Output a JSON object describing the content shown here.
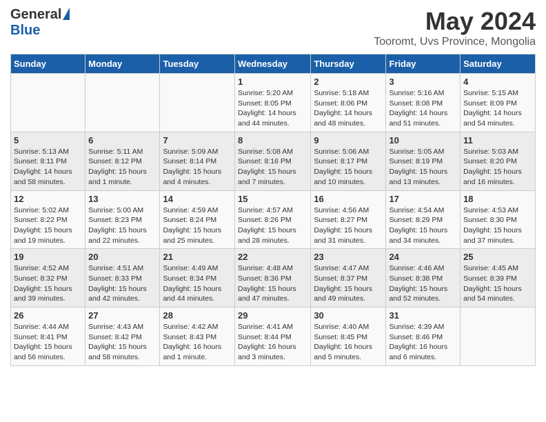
{
  "logo": {
    "general": "General",
    "blue": "Blue"
  },
  "title": "May 2024",
  "subtitle": "Tooromt, Uvs Province, Mongolia",
  "days_of_week": [
    "Sunday",
    "Monday",
    "Tuesday",
    "Wednesday",
    "Thursday",
    "Friday",
    "Saturday"
  ],
  "weeks": [
    [
      {
        "day": "",
        "info": ""
      },
      {
        "day": "",
        "info": ""
      },
      {
        "day": "",
        "info": ""
      },
      {
        "day": "1",
        "info": "Sunrise: 5:20 AM\nSunset: 8:05 PM\nDaylight: 14 hours\nand 44 minutes."
      },
      {
        "day": "2",
        "info": "Sunrise: 5:18 AM\nSunset: 8:06 PM\nDaylight: 14 hours\nand 48 minutes."
      },
      {
        "day": "3",
        "info": "Sunrise: 5:16 AM\nSunset: 8:08 PM\nDaylight: 14 hours\nand 51 minutes."
      },
      {
        "day": "4",
        "info": "Sunrise: 5:15 AM\nSunset: 8:09 PM\nDaylight: 14 hours\nand 54 minutes."
      }
    ],
    [
      {
        "day": "5",
        "info": "Sunrise: 5:13 AM\nSunset: 8:11 PM\nDaylight: 14 hours\nand 58 minutes."
      },
      {
        "day": "6",
        "info": "Sunrise: 5:11 AM\nSunset: 8:12 PM\nDaylight: 15 hours\nand 1 minute."
      },
      {
        "day": "7",
        "info": "Sunrise: 5:09 AM\nSunset: 8:14 PM\nDaylight: 15 hours\nand 4 minutes."
      },
      {
        "day": "8",
        "info": "Sunrise: 5:08 AM\nSunset: 8:16 PM\nDaylight: 15 hours\nand 7 minutes."
      },
      {
        "day": "9",
        "info": "Sunrise: 5:06 AM\nSunset: 8:17 PM\nDaylight: 15 hours\nand 10 minutes."
      },
      {
        "day": "10",
        "info": "Sunrise: 5:05 AM\nSunset: 8:19 PM\nDaylight: 15 hours\nand 13 minutes."
      },
      {
        "day": "11",
        "info": "Sunrise: 5:03 AM\nSunset: 8:20 PM\nDaylight: 15 hours\nand 16 minutes."
      }
    ],
    [
      {
        "day": "12",
        "info": "Sunrise: 5:02 AM\nSunset: 8:22 PM\nDaylight: 15 hours\nand 19 minutes."
      },
      {
        "day": "13",
        "info": "Sunrise: 5:00 AM\nSunset: 8:23 PM\nDaylight: 15 hours\nand 22 minutes."
      },
      {
        "day": "14",
        "info": "Sunrise: 4:59 AM\nSunset: 8:24 PM\nDaylight: 15 hours\nand 25 minutes."
      },
      {
        "day": "15",
        "info": "Sunrise: 4:57 AM\nSunset: 8:26 PM\nDaylight: 15 hours\nand 28 minutes."
      },
      {
        "day": "16",
        "info": "Sunrise: 4:56 AM\nSunset: 8:27 PM\nDaylight: 15 hours\nand 31 minutes."
      },
      {
        "day": "17",
        "info": "Sunrise: 4:54 AM\nSunset: 8:29 PM\nDaylight: 15 hours\nand 34 minutes."
      },
      {
        "day": "18",
        "info": "Sunrise: 4:53 AM\nSunset: 8:30 PM\nDaylight: 15 hours\nand 37 minutes."
      }
    ],
    [
      {
        "day": "19",
        "info": "Sunrise: 4:52 AM\nSunset: 8:32 PM\nDaylight: 15 hours\nand 39 minutes."
      },
      {
        "day": "20",
        "info": "Sunrise: 4:51 AM\nSunset: 8:33 PM\nDaylight: 15 hours\nand 42 minutes."
      },
      {
        "day": "21",
        "info": "Sunrise: 4:49 AM\nSunset: 8:34 PM\nDaylight: 15 hours\nand 44 minutes."
      },
      {
        "day": "22",
        "info": "Sunrise: 4:48 AM\nSunset: 8:36 PM\nDaylight: 15 hours\nand 47 minutes."
      },
      {
        "day": "23",
        "info": "Sunrise: 4:47 AM\nSunset: 8:37 PM\nDaylight: 15 hours\nand 49 minutes."
      },
      {
        "day": "24",
        "info": "Sunrise: 4:46 AM\nSunset: 8:38 PM\nDaylight: 15 hours\nand 52 minutes."
      },
      {
        "day": "25",
        "info": "Sunrise: 4:45 AM\nSunset: 8:39 PM\nDaylight: 15 hours\nand 54 minutes."
      }
    ],
    [
      {
        "day": "26",
        "info": "Sunrise: 4:44 AM\nSunset: 8:41 PM\nDaylight: 15 hours\nand 56 minutes."
      },
      {
        "day": "27",
        "info": "Sunrise: 4:43 AM\nSunset: 8:42 PM\nDaylight: 15 hours\nand 58 minutes."
      },
      {
        "day": "28",
        "info": "Sunrise: 4:42 AM\nSunset: 8:43 PM\nDaylight: 16 hours\nand 1 minute."
      },
      {
        "day": "29",
        "info": "Sunrise: 4:41 AM\nSunset: 8:44 PM\nDaylight: 16 hours\nand 3 minutes."
      },
      {
        "day": "30",
        "info": "Sunrise: 4:40 AM\nSunset: 8:45 PM\nDaylight: 16 hours\nand 5 minutes."
      },
      {
        "day": "31",
        "info": "Sunrise: 4:39 AM\nSunset: 8:46 PM\nDaylight: 16 hours\nand 6 minutes."
      },
      {
        "day": "",
        "info": ""
      }
    ]
  ]
}
